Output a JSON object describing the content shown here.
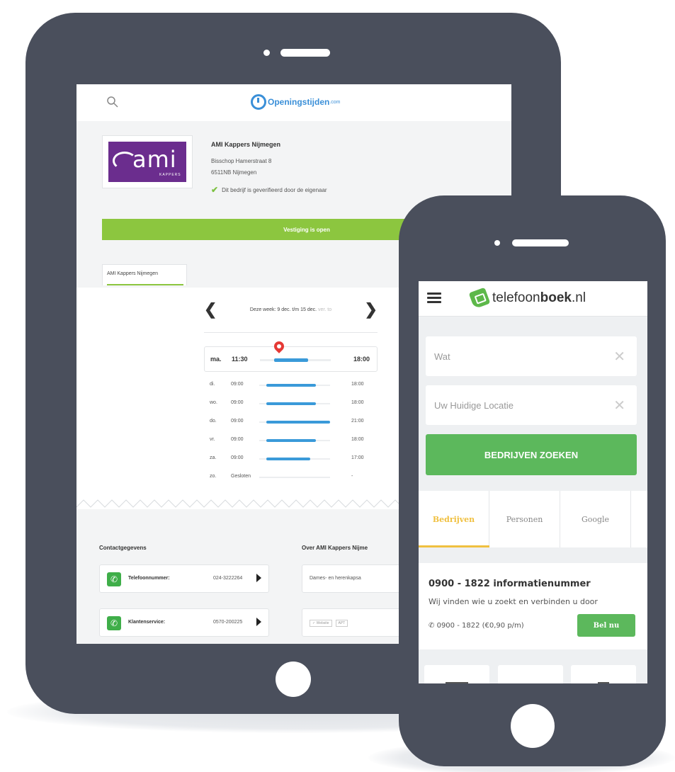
{
  "tablet": {
    "site_logo": "Openingstijden",
    "site_logo_suffix": ".com",
    "business": {
      "logo_text": "ami",
      "logo_subtext": "KAPPERS",
      "name": "AMI Kappers Nijmegen",
      "address_line1": "Bisschop Hamerstraat 8",
      "address_line2": "6511NB Nijmegen",
      "verified_text": "Dit bedrijf is geverifieerd door de eigenaar",
      "status_bar": "Vestiging is open",
      "tab_label": "AMI Kappers Nijmegen"
    },
    "week_label": "Deze week: 9 dec. t/m 15 dec.",
    "week_label_faded": "ver. to",
    "today": {
      "day": "ma.",
      "open": "11:30",
      "close": "18:00",
      "fill": 0.48
    },
    "hours": [
      {
        "day": "di.",
        "open": "09:00",
        "close": "18:00",
        "fill": 0.7
      },
      {
        "day": "wo.",
        "open": "09:00",
        "close": "18:00",
        "fill": 0.7
      },
      {
        "day": "do.",
        "open": "09:00",
        "close": "21:00",
        "fill": 0.9
      },
      {
        "day": "vr.",
        "open": "09:00",
        "close": "18:00",
        "fill": 0.7
      },
      {
        "day": "za.",
        "open": "09:00",
        "close": "17:00",
        "fill": 0.62
      },
      {
        "day": "zo.",
        "open": "Gesloten",
        "close": "-",
        "fill": 0
      }
    ],
    "contact_title": "Contactgegevens",
    "about_title": "Over AMI Kappers Nijme",
    "contacts": [
      {
        "label": "Telefoonnummer:",
        "value": "024-3222264"
      },
      {
        "label": "Klantenservice:",
        "value": "0570-200225"
      }
    ],
    "about_text": "Dames- en herenkapsa",
    "tags": [
      "✓ Website",
      "APT"
    ]
  },
  "phone": {
    "logo_text_light": "telefoon",
    "logo_text_bold": "boek",
    "logo_text_tld": ".nl",
    "what_placeholder": "Wat",
    "location_placeholder": "Uw Huidige Locatie",
    "clear_glyph": "✕",
    "search_button": "BEDRIJVEN ZOEKEN",
    "tabs": [
      "Bedrijven",
      "Personen",
      "Google"
    ],
    "result": {
      "title": "0900 - 1822 informatienummer",
      "subtitle": "Wij vinden wie u zoekt en verbinden u door",
      "phone": "0900 - 1822 (€0,90 p/m)",
      "call_button": "Bel nu"
    }
  },
  "colors": {
    "device": "#4a4f5c",
    "green": "#5cb85c",
    "lime": "#8cc63f",
    "blue": "#3a9ad9",
    "yellow": "#f0c040",
    "purple": "#6b2d8e"
  }
}
